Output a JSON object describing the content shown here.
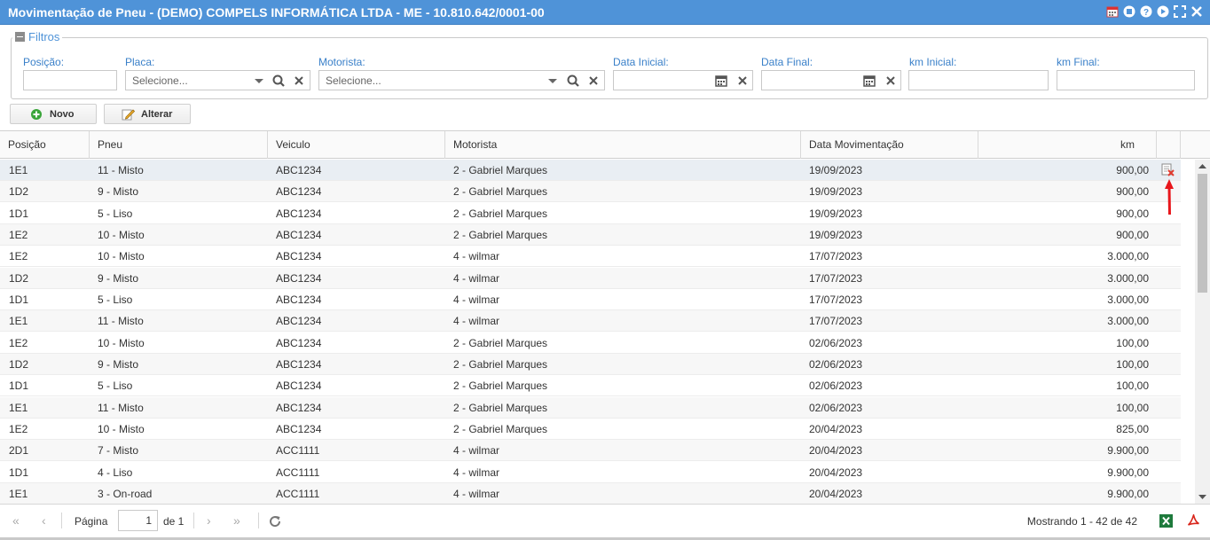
{
  "window": {
    "title": "Movimentação de Pneu - (DEMO) COMPELS INFORMÁTICA LTDA - ME - 10.810.642/0001-00"
  },
  "filters": {
    "legend": "Filtros",
    "posicao_label": "Posição:",
    "placa_label": "Placa:",
    "placa_placeholder": "Selecione...",
    "motorista_label": "Motorista:",
    "motorista_placeholder": "Selecione...",
    "data_inicial_label": "Data Inicial:",
    "data_final_label": "Data Final:",
    "km_inicial_label": "km Inicial:",
    "km_final_label": "km Final:"
  },
  "toolbar": {
    "novo_label": "Novo",
    "alterar_label": "Alterar"
  },
  "columns": [
    "Posição",
    "Pneu",
    "Veiculo",
    "Motorista",
    "Data Movimentação",
    "km"
  ],
  "rows": [
    {
      "posicao": "1E1",
      "pneu": "11 - Misto",
      "veiculo": "ABC1234",
      "motorista": "2 - Gabriel Marques",
      "data": "19/09/2023",
      "km": "900,00"
    },
    {
      "posicao": "1D2",
      "pneu": "9 - Misto",
      "veiculo": "ABC1234",
      "motorista": "2 - Gabriel Marques",
      "data": "19/09/2023",
      "km": "900,00"
    },
    {
      "posicao": "1D1",
      "pneu": "5 - Liso",
      "veiculo": "ABC1234",
      "motorista": "2 - Gabriel Marques",
      "data": "19/09/2023",
      "km": "900,00"
    },
    {
      "posicao": "1E2",
      "pneu": "10 - Misto",
      "veiculo": "ABC1234",
      "motorista": "2 - Gabriel Marques",
      "data": "19/09/2023",
      "km": "900,00"
    },
    {
      "posicao": "1E2",
      "pneu": "10 - Misto",
      "veiculo": "ABC1234",
      "motorista": "4 - wilmar",
      "data": "17/07/2023",
      "km": "3.000,00"
    },
    {
      "posicao": "1D2",
      "pneu": "9 - Misto",
      "veiculo": "ABC1234",
      "motorista": "4 - wilmar",
      "data": "17/07/2023",
      "km": "3.000,00"
    },
    {
      "posicao": "1D1",
      "pneu": "5 - Liso",
      "veiculo": "ABC1234",
      "motorista": "4 - wilmar",
      "data": "17/07/2023",
      "km": "3.000,00"
    },
    {
      "posicao": "1E1",
      "pneu": "11 - Misto",
      "veiculo": "ABC1234",
      "motorista": "4 - wilmar",
      "data": "17/07/2023",
      "km": "3.000,00"
    },
    {
      "posicao": "1E2",
      "pneu": "10 - Misto",
      "veiculo": "ABC1234",
      "motorista": "2 - Gabriel Marques",
      "data": "02/06/2023",
      "km": "100,00"
    },
    {
      "posicao": "1D2",
      "pneu": "9 - Misto",
      "veiculo": "ABC1234",
      "motorista": "2 - Gabriel Marques",
      "data": "02/06/2023",
      "km": "100,00"
    },
    {
      "posicao": "1D1",
      "pneu": "5 - Liso",
      "veiculo": "ABC1234",
      "motorista": "2 - Gabriel Marques",
      "data": "02/06/2023",
      "km": "100,00"
    },
    {
      "posicao": "1E1",
      "pneu": "11 - Misto",
      "veiculo": "ABC1234",
      "motorista": "2 - Gabriel Marques",
      "data": "02/06/2023",
      "km": "100,00"
    },
    {
      "posicao": "1E2",
      "pneu": "10 - Misto",
      "veiculo": "ABC1234",
      "motorista": "2 - Gabriel Marques",
      "data": "20/04/2023",
      "km": "825,00"
    },
    {
      "posicao": "2D1",
      "pneu": "7 - Misto",
      "veiculo": "ACC1111",
      "motorista": "4 - wilmar",
      "data": "20/04/2023",
      "km": "9.900,00"
    },
    {
      "posicao": "1D1",
      "pneu": "4 - Liso",
      "veiculo": "ACC1111",
      "motorista": "4 - wilmar",
      "data": "20/04/2023",
      "km": "9.900,00"
    },
    {
      "posicao": "1E1",
      "pneu": "3 - On-road",
      "veiculo": "ACC1111",
      "motorista": "4 - wilmar",
      "data": "20/04/2023",
      "km": "9.900,00"
    }
  ],
  "pager": {
    "page_label": "Página",
    "page_value": "1",
    "of_label": "de 1",
    "status": "Mostrando 1 - 42 de 42"
  },
  "colors": {
    "titlebar": "#4f93d8",
    "label": "#3a80c9",
    "annotation_arrow": "#e8161b"
  },
  "icons": [
    "calendar-icon",
    "stop-icon",
    "help-icon",
    "play-icon",
    "fullscreen-icon",
    "search-icon",
    "clear-icon",
    "dropdown-icon",
    "add-icon",
    "edit-icon",
    "delete-icon",
    "refresh-icon",
    "excel-icon",
    "pdf-icon"
  ]
}
